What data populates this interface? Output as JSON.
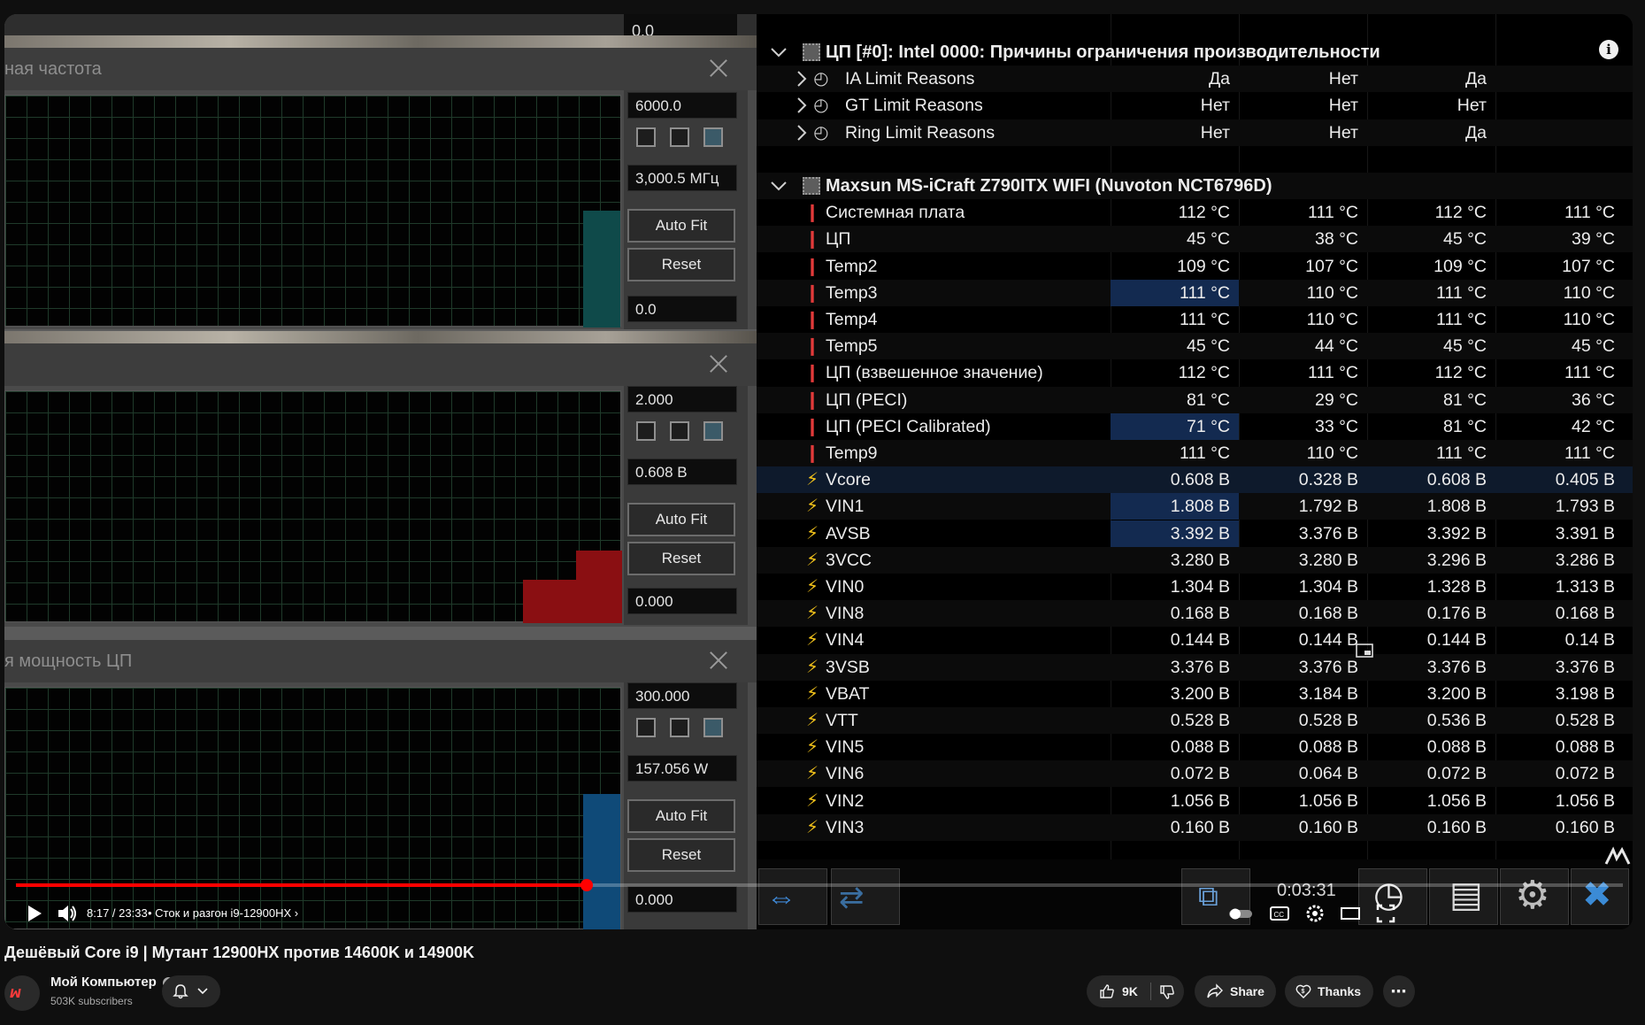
{
  "graphs": {
    "top_value": "0.0",
    "windows": [
      {
        "title": "ная частота",
        "max": "6000.0",
        "current": "3,000.5 МГц",
        "min": "0.0",
        "autofit": "Auto Fit",
        "reset": "Reset",
        "bar_color": "#0f4a4a"
      },
      {
        "title": "",
        "max": "2.000",
        "current": "0.608 В",
        "min": "0.000",
        "autofit": "Auto Fit",
        "reset": "Reset",
        "bar_color": "#8a0f12"
      },
      {
        "title": "я мощность ЦП",
        "max": "300.000",
        "current": "157.056 W",
        "min": "0.000",
        "autofit": "Auto Fit",
        "reset": "Reset",
        "bar_color": "#0f4a78"
      }
    ]
  },
  "sensors": {
    "group1": {
      "title": "ЦП [#0]: Intel 0000: Причины ограничения производительности",
      "rows": [
        {
          "label": "IA Limit Reasons",
          "v1": "Да",
          "v2": "Нет",
          "v3": "Да",
          "v4": ""
        },
        {
          "label": "GT Limit Reasons",
          "v1": "Нет",
          "v2": "Нет",
          "v3": "Нет",
          "v4": ""
        },
        {
          "label": "Ring Limit Reasons",
          "v1": "Нет",
          "v2": "Нет",
          "v3": "Да",
          "v4": ""
        }
      ]
    },
    "group2": {
      "title": "Maxsun MS-iCraft Z790ITX WIFI (Nuvoton NCT6796D)",
      "temps": [
        {
          "label": "Системная плата",
          "v1": "112 °C",
          "v2": "111 °C",
          "v3": "112 °C",
          "v4": "111 °C"
        },
        {
          "label": "ЦП",
          "v1": "45 °C",
          "v2": "38 °C",
          "v3": "45 °C",
          "v4": "39 °C"
        },
        {
          "label": "Temp2",
          "v1": "109 °C",
          "v2": "107 °C",
          "v3": "109 °C",
          "v4": "107 °C"
        },
        {
          "label": "Temp3",
          "v1": "111 °C",
          "v2": "110 °C",
          "v3": "111 °C",
          "v4": "110 °C"
        },
        {
          "label": "Temp4",
          "v1": "111 °C",
          "v2": "110 °C",
          "v3": "111 °C",
          "v4": "110 °C"
        },
        {
          "label": "Temp5",
          "v1": "45 °C",
          "v2": "44 °C",
          "v3": "45 °C",
          "v4": "45 °C"
        },
        {
          "label": "ЦП (взвешенное значение)",
          "v1": "112 °C",
          "v2": "111 °C",
          "v3": "112 °C",
          "v4": "111 °C"
        },
        {
          "label": "ЦП (PECI)",
          "v1": "81 °C",
          "v2": "29 °C",
          "v3": "81 °C",
          "v4": "36 °C"
        },
        {
          "label": "ЦП (PECI Calibrated)",
          "v1": "71 °C",
          "v2": "33 °C",
          "v3": "81 °C",
          "v4": "42 °C"
        },
        {
          "label": "Temp9",
          "v1": "111 °C",
          "v2": "110 °C",
          "v3": "111 °C",
          "v4": "111 °C"
        }
      ],
      "volts": [
        {
          "label": "Vcore",
          "v1": "0.608 В",
          "v2": "0.328 В",
          "v3": "0.608 В",
          "v4": "0.405 В"
        },
        {
          "label": "VIN1",
          "v1": "1.808 В",
          "v2": "1.792 В",
          "v3": "1.808 В",
          "v4": "1.793 В"
        },
        {
          "label": "AVSB",
          "v1": "3.392 В",
          "v2": "3.376 В",
          "v3": "3.392 В",
          "v4": "3.391 В"
        },
        {
          "label": "3VCC",
          "v1": "3.280 В",
          "v2": "3.280 В",
          "v3": "3.296 В",
          "v4": "3.286 В"
        },
        {
          "label": "VIN0",
          "v1": "1.304 В",
          "v2": "1.304 В",
          "v3": "1.328 В",
          "v4": "1.313 В"
        },
        {
          "label": "VIN8",
          "v1": "0.168 В",
          "v2": "0.168 В",
          "v3": "0.176 В",
          "v4": "0.168 В"
        },
        {
          "label": "VIN4",
          "v1": "0.144 В",
          "v2": "0.144 В",
          "v3": "0.144 В",
          "v4": "0.14 В"
        },
        {
          "label": "3VSB",
          "v1": "3.376 В",
          "v2": "3.376 В",
          "v3": "3.376 В",
          "v4": "3.376 В"
        },
        {
          "label": "VBAT",
          "v1": "3.200 В",
          "v2": "3.184 В",
          "v3": "3.200 В",
          "v4": "3.198 В"
        },
        {
          "label": "VTT",
          "v1": "0.528 В",
          "v2": "0.528 В",
          "v3": "0.536 В",
          "v4": "0.528 В"
        },
        {
          "label": "VIN5",
          "v1": "0.088 В",
          "v2": "0.088 В",
          "v3": "0.088 В",
          "v4": "0.088 В"
        },
        {
          "label": "VIN6",
          "v1": "0.072 В",
          "v2": "0.064 В",
          "v3": "0.072 В",
          "v4": "0.072 В"
        },
        {
          "label": "VIN2",
          "v1": "1.056 В",
          "v2": "1.056 В",
          "v3": "1.056 В",
          "v4": "1.056 В"
        },
        {
          "label": "VIN3",
          "v1": "0.160 В",
          "v2": "0.160 В",
          "v3": "0.160 В",
          "v4": "0.160 В"
        }
      ]
    },
    "timer": "0:03:31"
  },
  "player": {
    "time": "8:17 / 23:33",
    "chapter": "• Сток и разгон i9-12900HX",
    "progress_fraction": 0.355
  },
  "video": {
    "title": "Дешёвый Core i9 | Мутант 12900HX против 14600K и 14900K",
    "channel": "Мой Компьютер",
    "subscribers": "503K subscribers",
    "likes": "9K",
    "share": "Share",
    "thanks": "Thanks"
  },
  "colors": {
    "accent": "#ff0000",
    "selection": "#132a50",
    "volt_icon": "#f2c21a",
    "temp_icon": "#e23a3a"
  }
}
